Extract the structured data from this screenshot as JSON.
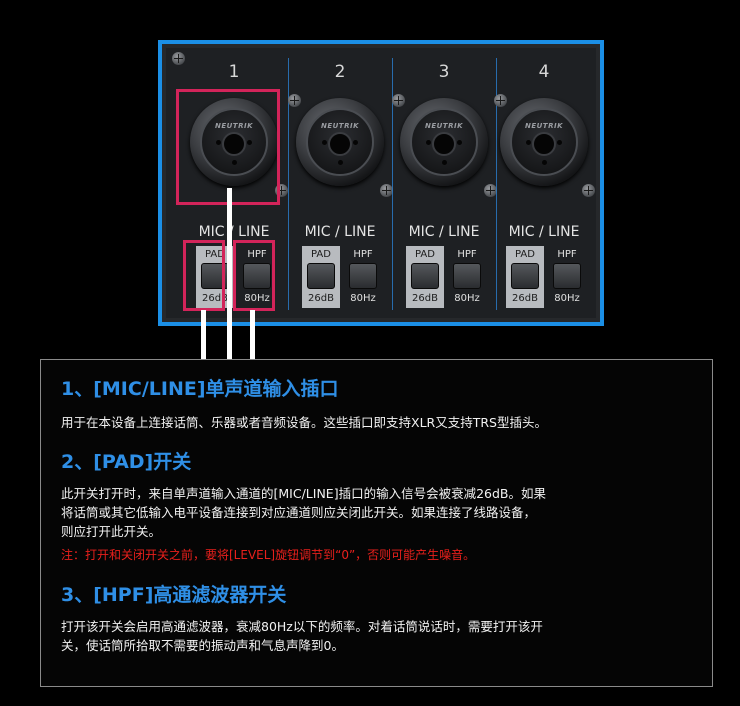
{
  "panel": {
    "channels": [
      {
        "number": "1",
        "brand": "NEUTRIK",
        "label": "MIC / LINE",
        "pad_label": "PAD",
        "pad_value": "26dB",
        "hpf_label": "HPF",
        "hpf_value": "80Hz"
      },
      {
        "number": "2",
        "brand": "NEUTRIK",
        "label": "MIC / LINE",
        "pad_label": "PAD",
        "pad_value": "26dB",
        "hpf_label": "HPF",
        "hpf_value": "80Hz"
      },
      {
        "number": "3",
        "brand": "NEUTRIK",
        "label": "MIC / LINE",
        "pad_label": "PAD",
        "pad_value": "26dB",
        "hpf_label": "HPF",
        "hpf_value": "80Hz"
      },
      {
        "number": "4",
        "brand": "NEUTRIK",
        "label": "MIC / LINE",
        "pad_label": "PAD",
        "pad_value": "26dB",
        "hpf_label": "HPF",
        "hpf_value": "80Hz"
      }
    ],
    "colors": {
      "border": "#1b8fe6",
      "highlight": "#d3245a"
    }
  },
  "info": {
    "sections": [
      {
        "title": "1、[MIC/LINE]单声道输入插口",
        "lines": [
          "用于在本设备上连接话筒、乐器或者音频设备。这些插口即支持XLR又支持TRS型插头。"
        ]
      },
      {
        "title": "2、[PAD]开关",
        "lines": [
          "此开关打开时，来自单声道输入通道的[MIC/LINE]插口的输入信号会被衰减26dB。如果",
          "将话筒或其它低输入电平设备连接到对应通道则应关闭此开关。如果连接了线路设备，",
          "则应打开此开关。"
        ],
        "note": "注：打开和关闭开关之前，要将[LEVEL]旋钮调节到“0”，否则可能产生噪音。"
      },
      {
        "title": "3、[HPF]高通滤波器开关",
        "lines": [
          "打开该开关会启用高通滤波器，衰减80Hz以下的频率。对着话筒说话时，需要打开该开",
          "关，使话筒所拾取不需要的振动声和气息声降到0。"
        ]
      }
    ],
    "colors": {
      "title": "#2f8fe6",
      "note": "#e8201c"
    }
  }
}
